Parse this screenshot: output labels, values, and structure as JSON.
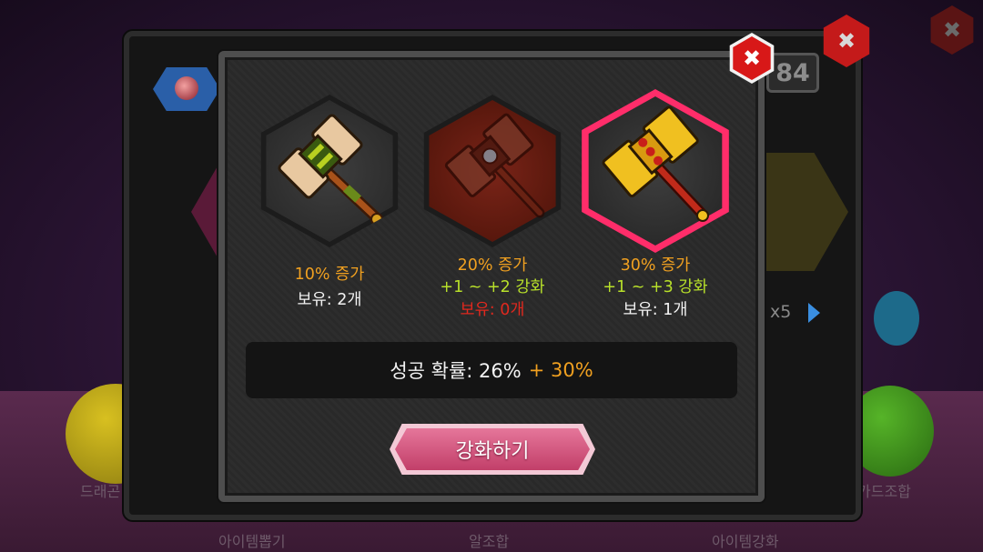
{
  "background": {
    "bottom_labels": [
      "드래곤",
      "아이템뽑기",
      "알조합",
      "아이템강화",
      "카드조합"
    ]
  },
  "back_panel": {
    "count_value": "84",
    "multiplier": "x5",
    "accent": "#3a8ee0"
  },
  "dialog": {
    "close_label": "✖",
    "items": [
      {
        "icon": "hammer-gold-green-icon",
        "bonus": "10% 증가",
        "enhance": "",
        "owned": "보유: 2개",
        "owned_status": "normal",
        "selected": false
      },
      {
        "icon": "hammer-dark-red-icon",
        "bonus": "20% 증가",
        "enhance": "+1 ~ +2 강화",
        "owned": "보유: 0개",
        "owned_status": "none",
        "selected": false
      },
      {
        "icon": "hammer-gold-ornate-icon",
        "bonus": "30% 증가",
        "enhance": "+1 ~ +3 강화",
        "owned": "보유: 1개",
        "owned_status": "normal",
        "selected": true
      }
    ],
    "success_rate_label": "성공 확률: 26%",
    "success_rate_bonus": "+ 30%",
    "enhance_button": "강화하기"
  },
  "colors": {
    "orange": "#f0a020",
    "green": "#b8e02a",
    "red": "#e0281e",
    "selected_border": "#ff2d6a",
    "button": "#d45a82"
  }
}
